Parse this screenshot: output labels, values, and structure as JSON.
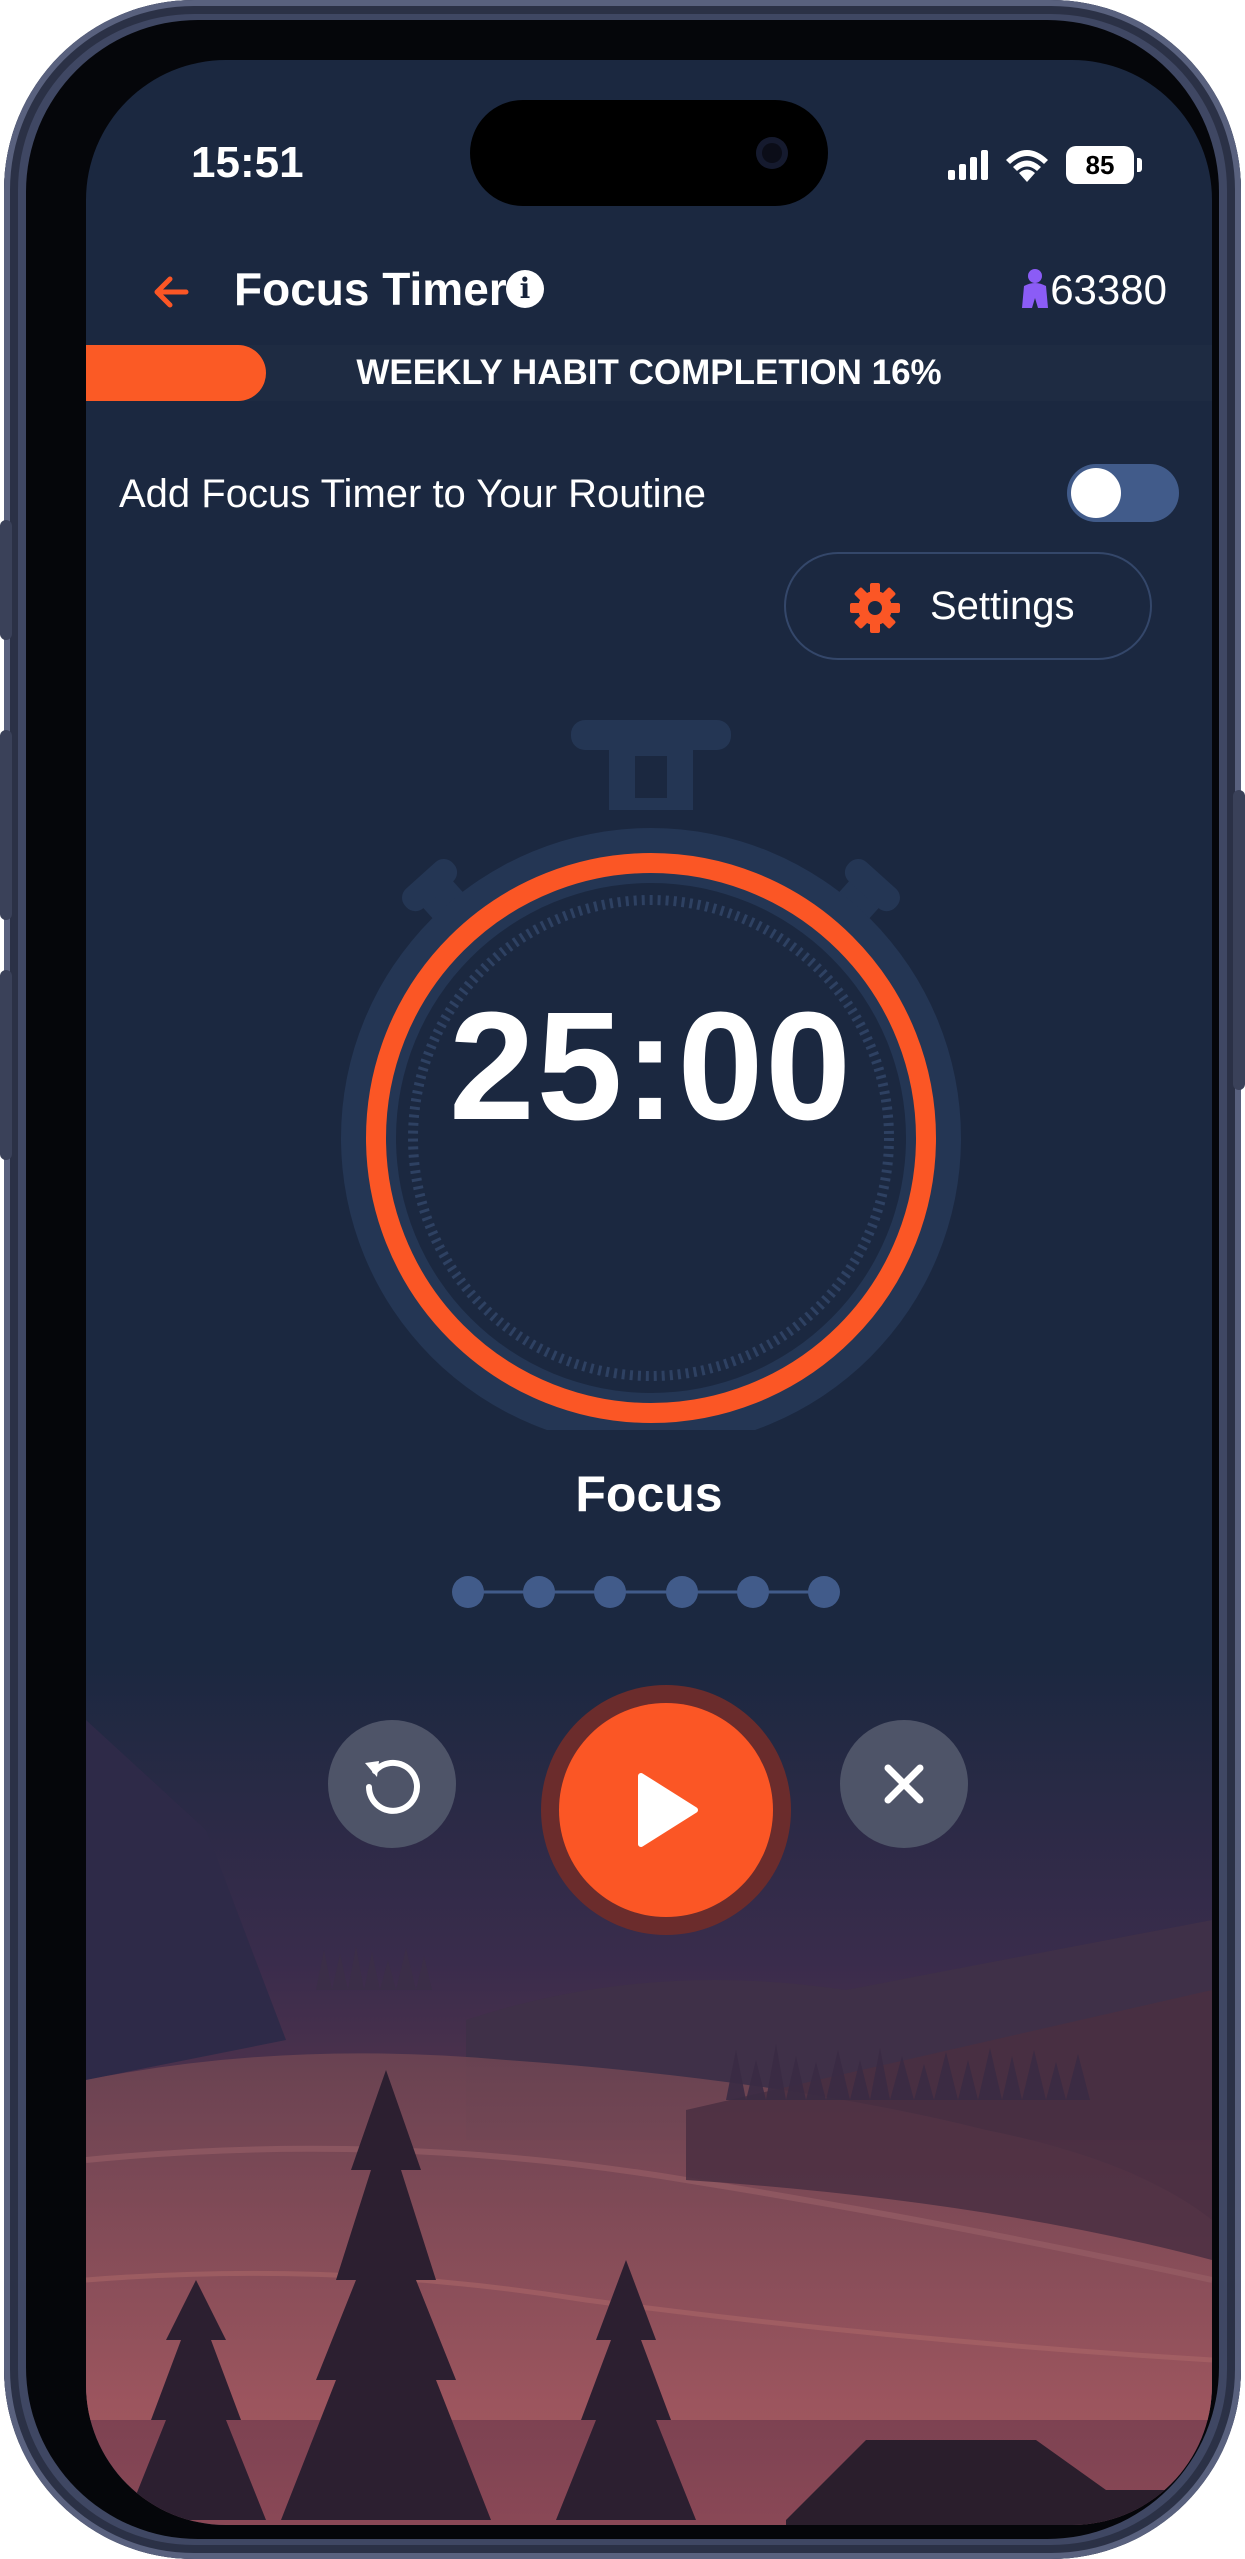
{
  "status_bar": {
    "time": "15:51",
    "battery": "85"
  },
  "header": {
    "title": "Focus Timer",
    "info_icon": "i",
    "coins": "63380"
  },
  "weekly": {
    "label": "WEEKLY HABIT COMPLETION 16%",
    "progress_percent": 16
  },
  "routine": {
    "label": "Add Focus Timer to Your Routine",
    "enabled": false
  },
  "settings": {
    "label": "Settings"
  },
  "timer": {
    "time": "25:00",
    "mode": "Focus",
    "sessions_total": 6
  },
  "controls": {
    "reset_icon": "reset-icon",
    "play_icon": "play-icon",
    "close_icon": "close-icon"
  },
  "colors": {
    "accent": "#fb5625",
    "background": "#1b2840",
    "toggle_track": "#415b8a"
  }
}
